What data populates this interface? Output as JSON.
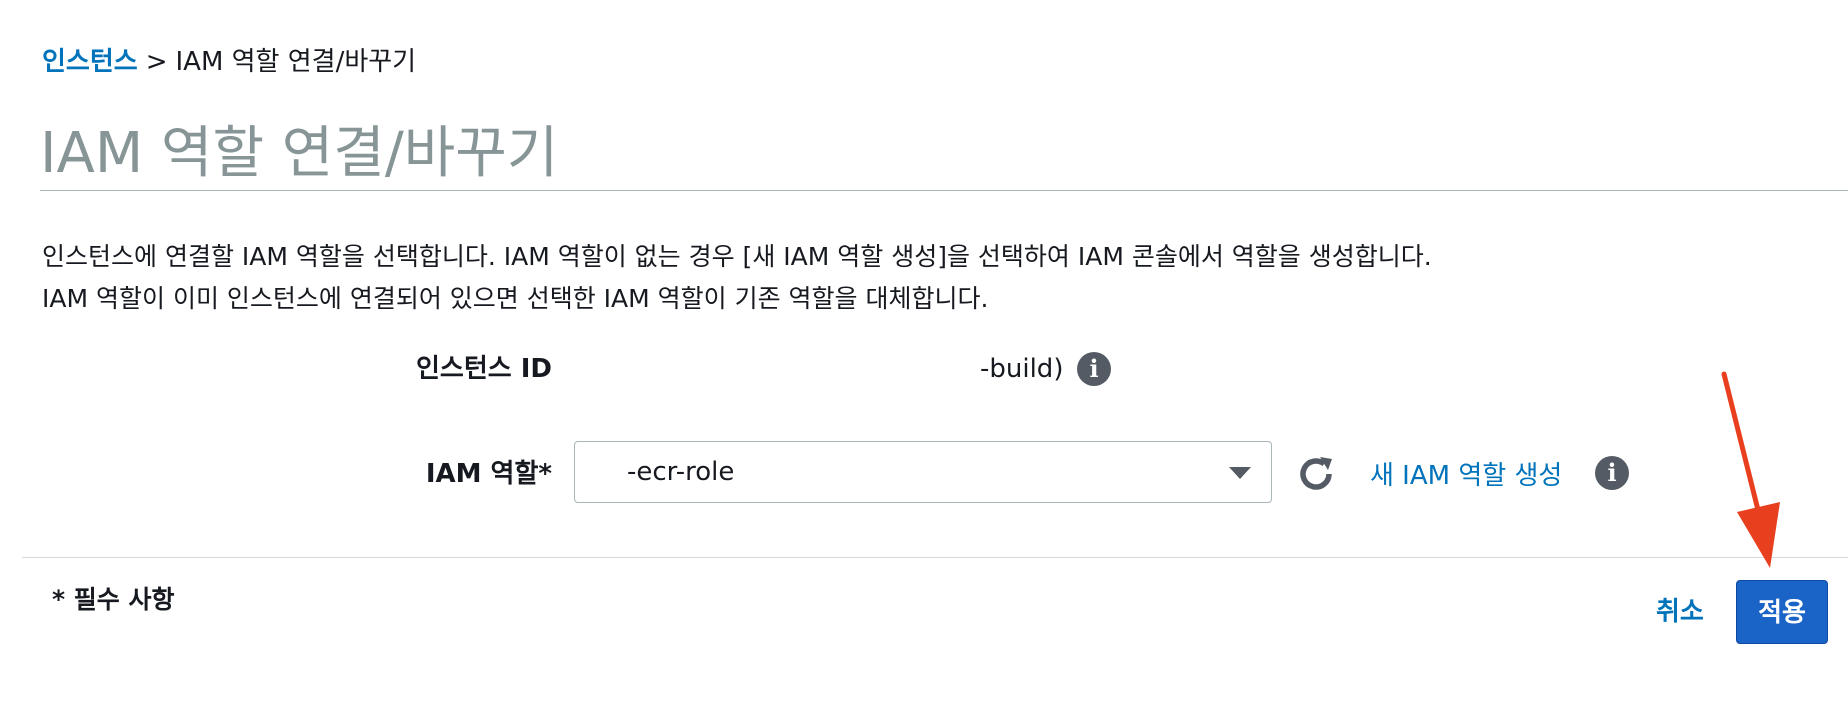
{
  "breadcrumb": {
    "link_label": "인스턴스",
    "separator": ">",
    "current": "IAM 역할 연결/바꾸기"
  },
  "page": {
    "title": "IAM 역할 연결/바꾸기",
    "description_line1": "인스턴스에 연결할 IAM 역할을 선택합니다. IAM 역할이 없는 경우 [새 IAM 역할 생성]을 선택하여 IAM 콘솔에서 역할을 생성합니다.",
    "description_line2": "IAM 역할이 이미 인스턴스에 연결되어 있으면 선택한 IAM 역할이 기존 역할을 대체합니다."
  },
  "form": {
    "instance_id_label": "인스턴스 ID",
    "instance_id_value": "-build)",
    "iam_role_label": "IAM 역할*",
    "iam_role_selected": "-ecr-role",
    "create_role_link": "새 IAM 역할 생성"
  },
  "footer": {
    "required_note": "* 필수 사항",
    "cancel_label": "취소",
    "apply_label": "적용"
  },
  "icons": {
    "info": "info-icon",
    "refresh": "refresh-icon",
    "dropdown": "chevron-down-icon",
    "annotation": "red-arrow-annotation"
  },
  "colors": {
    "link": "#0073bb",
    "primary_button": "#1a64c8",
    "title": "#879596",
    "annotation_arrow": "#e8401f"
  }
}
